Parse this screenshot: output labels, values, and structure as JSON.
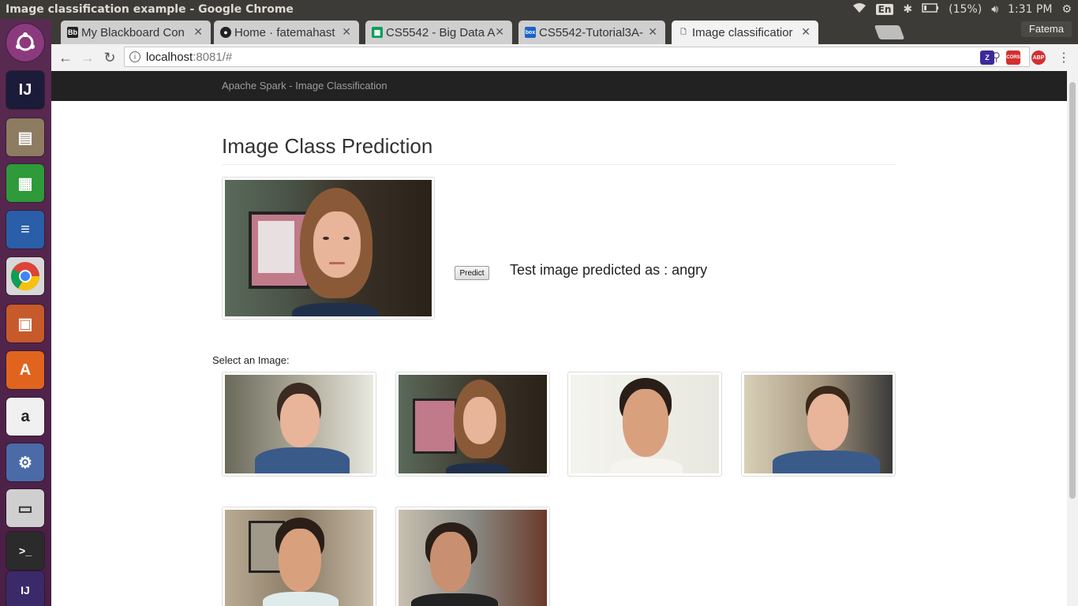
{
  "os": {
    "window_title": "Image classification example - Google Chrome",
    "keyboard": "En",
    "battery": "(15%)",
    "clock": "1:31 PM"
  },
  "browser": {
    "profile": "Fatema",
    "tabs": [
      {
        "label": "My Blackboard Con",
        "icon": "Bb"
      },
      {
        "label": "Home · fatemahast",
        "icon": "github-icon"
      },
      {
        "label": "CS5542 - Big Data A",
        "icon": "sheets-icon"
      },
      {
        "label": "CS5542-Tutorial3A-",
        "icon": "box"
      },
      {
        "label": "Image classificatior",
        "icon": "doc-icon"
      }
    ],
    "url_host": "localhost",
    "url_rest": ":8081/#",
    "extensions": [
      "Z",
      "CORS",
      "ABP"
    ]
  },
  "page": {
    "navbar_brand": "Apache Spark - Image Classification",
    "heading": "Image Class Prediction",
    "predict_label": "Predict",
    "result_text": "Test image predicted as : angry",
    "select_label": "Select an Image:"
  },
  "colors": {
    "navbar_bg": "#222222",
    "launcher_bg": "#4a1f45",
    "panel_bg": "#3c3b37"
  }
}
